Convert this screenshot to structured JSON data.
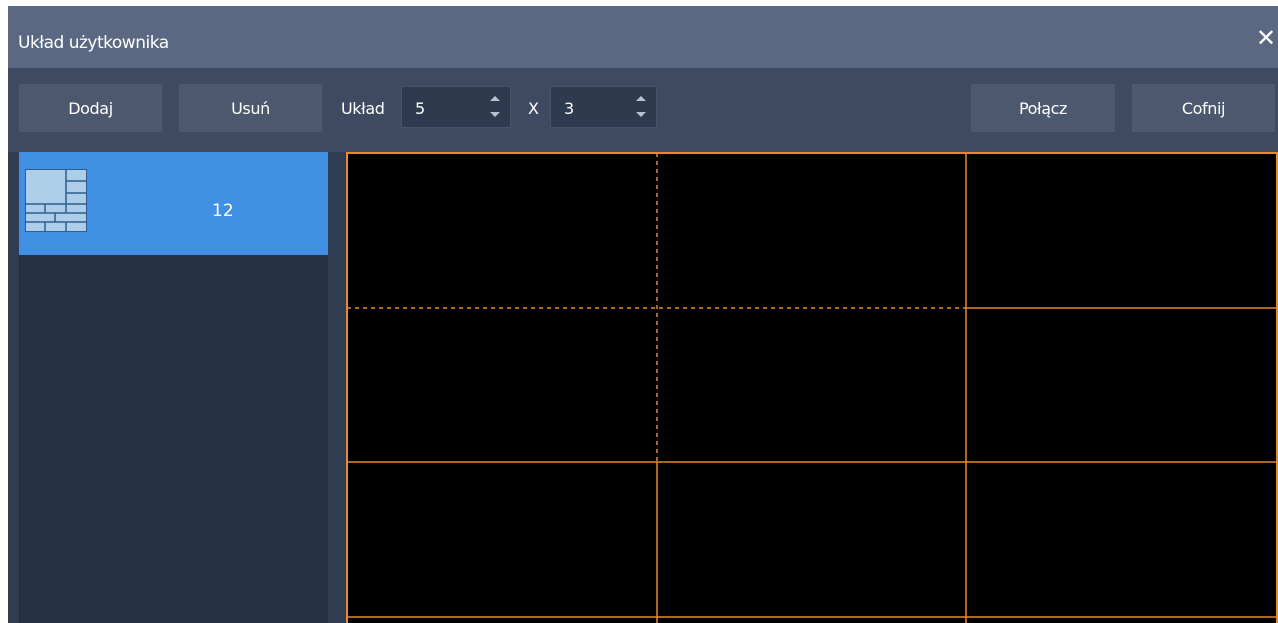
{
  "window": {
    "title": "Układ użytkownika",
    "close_icon": "close-icon"
  },
  "toolbar": {
    "add_label": "Dodaj",
    "remove_label": "Usuń",
    "layout_label": "Układ",
    "rows_value": "5",
    "times_label": "X",
    "cols_value": "3",
    "merge_label": "Połącz",
    "undo_label": "Cofnij"
  },
  "sidebar": {
    "items": [
      {
        "icon": "grid-layout-icon",
        "count": "12",
        "selected": true
      }
    ]
  },
  "canvas": {
    "grid_color": "#e8892b",
    "background": "#000000"
  },
  "colors": {
    "selected": "#3f8fe3",
    "titlebar": "#5a6981",
    "toolbar": "#3d4a61"
  }
}
